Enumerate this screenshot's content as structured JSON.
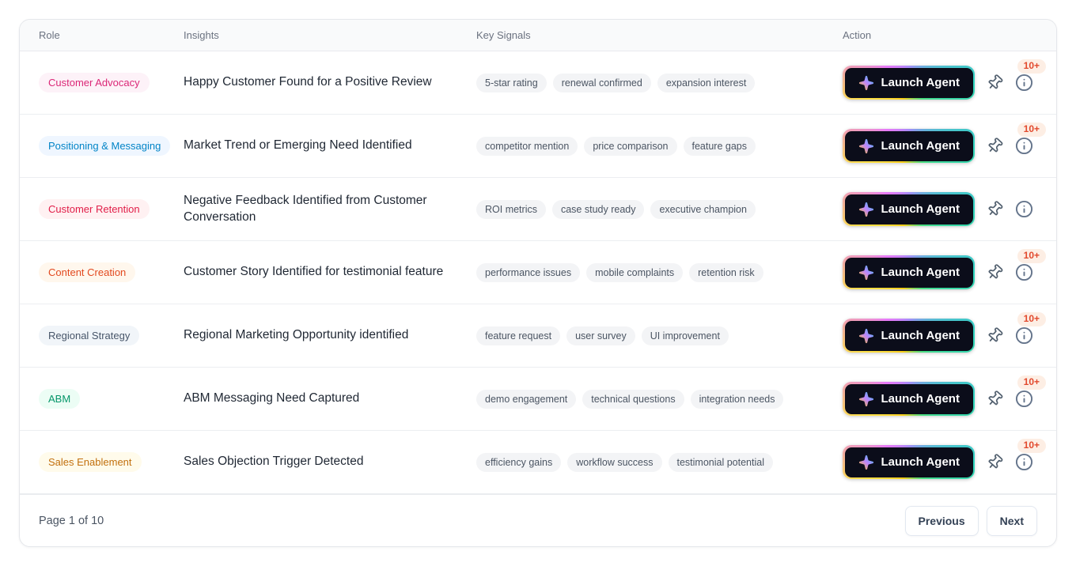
{
  "theme": {
    "card_border": "#e5e7eb",
    "header_bg": "#f9fafb",
    "header_text": "#6b7280",
    "insight_text": "#1f2733",
    "signal_pill_bg": "#f3f4f6",
    "signal_pill_text": "#4b5563",
    "launch_button_bg": "#0b0d1a",
    "launch_button_text": "#ffffff",
    "launch_border_gradient": [
      "#a78bfa",
      "#2dd4bf",
      "#4ade80",
      "#facc15",
      "#fde047",
      "#e879f9"
    ],
    "sparkle_gradient": [
      "#fbbf24",
      "#c084fc",
      "#38bdf8"
    ],
    "count_badge": {
      "color": "#e2492d",
      "bg": "#fdeee4"
    },
    "icon_color": "#52606f"
  },
  "table": {
    "columns": [
      "Role",
      "Insights",
      "Key Signals",
      "Action"
    ],
    "launch_button_label": "Launch Agent",
    "rows": [
      {
        "role": {
          "label": "Customer Advocacy",
          "color": "#db2777",
          "bg": "#fdf2f8"
        },
        "insight": "Happy Customer Found for a Positive Review",
        "signals": [
          "5-star rating",
          "renewal confirmed",
          "expansion interest"
        ],
        "count_badge": "10+"
      },
      {
        "role": {
          "label": "Positioning & Messaging",
          "color": "#0284c7",
          "bg": "#eff6ff"
        },
        "insight": "Market Trend or Emerging Need Identified",
        "signals": [
          "competitor mention",
          "price comparison",
          "feature gaps"
        ],
        "count_badge": "10+"
      },
      {
        "role": {
          "label": "Customer Retention",
          "color": "#e11d48",
          "bg": "#fff1f2"
        },
        "insight": "Negative Feedback Identified from Customer Conversation",
        "signals": [
          "ROI metrics",
          "case study ready",
          "executive champion"
        ],
        "count_badge": null
      },
      {
        "role": {
          "label": "Content Creation",
          "color": "#e2491f",
          "bg": "#fff7ed"
        },
        "insight": "Customer Story Identified for testimonial feature",
        "signals": [
          "performance issues",
          "mobile complaints",
          "retention risk"
        ],
        "count_badge": "10+"
      },
      {
        "role": {
          "label": "Regional Strategy",
          "color": "#475569",
          "bg": "#f1f5f9"
        },
        "insight": "Regional Marketing Opportunity identified",
        "signals": [
          "feature request",
          "user survey",
          "UI improvement"
        ],
        "count_badge": "10+"
      },
      {
        "role": {
          "label": "ABM",
          "color": "#059669",
          "bg": "#ecfdf5"
        },
        "insight": "ABM Messaging Need Captured",
        "signals": [
          "demo engagement",
          "technical questions",
          "integration needs"
        ],
        "count_badge": "10+"
      },
      {
        "role": {
          "label": "Sales Enablement",
          "color": "#c2700e",
          "bg": "#fffbeb"
        },
        "insight": "Sales Objection Trigger Detected",
        "signals": [
          "efficiency gains",
          "workflow success",
          "testimonial potential"
        ],
        "count_badge": "10+"
      }
    ]
  },
  "pagination": {
    "status": "Page 1 of 10",
    "previous_label": "Previous",
    "next_label": "Next"
  }
}
